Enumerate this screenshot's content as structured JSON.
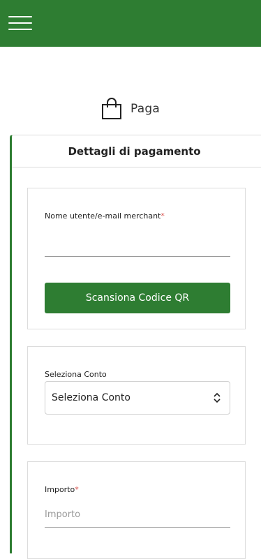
{
  "header": {
    "menu_icon": "hamburger-menu-icon",
    "brand_color": "#2e7d32"
  },
  "page": {
    "icon": "shopping-bag-icon",
    "title": "Paga"
  },
  "card": {
    "title": "Dettagli di pagamento"
  },
  "merchant": {
    "label": "Nome utente/e-mail merchant",
    "required_mark": "*",
    "value": "",
    "qr_button_label": "Scansiona Codice QR"
  },
  "account": {
    "label": "Seleziona Conto",
    "selected": "Seleziona Conto"
  },
  "amount": {
    "label": "Importo",
    "required_mark": "*",
    "placeholder": "Importo"
  }
}
